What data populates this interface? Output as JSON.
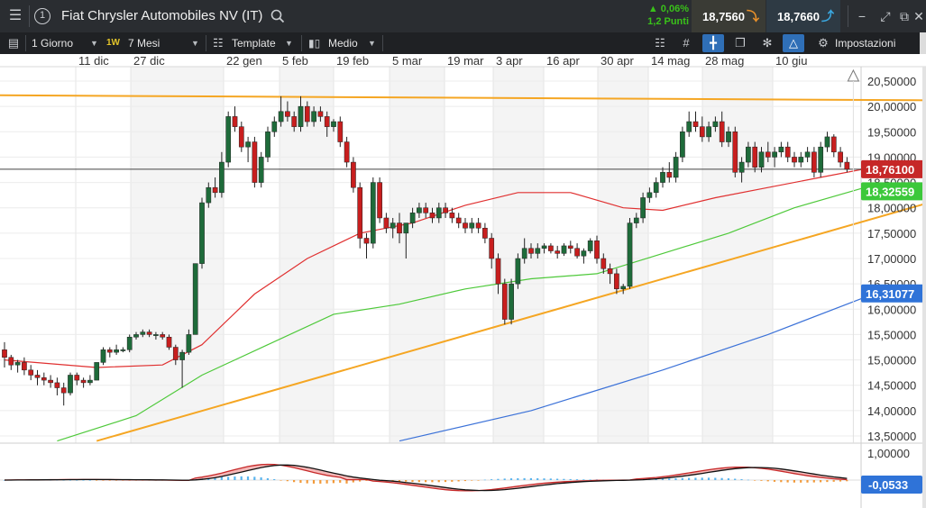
{
  "title_bar": {
    "menu_icon": "hamburger-menu-icon",
    "info_icon_glyph": "1",
    "instrument_name": "Fiat Chrysler Automobiles NV (IT)",
    "change_percent": "▲ 0,06%",
    "change_points": "1,2 Punti",
    "sell_price": "18,7560",
    "buy_price": "18,7660",
    "change_color": "#39c11a",
    "sell_arrow_color": "#e8902a",
    "buy_arrow_color": "#3aa8e0"
  },
  "toolbar": {
    "period_label": "1 Giorno",
    "week_badge": "1W",
    "range_label": "7 Mesi",
    "template_label": "Template",
    "chart_type_label": "Medio",
    "settings_label": "Impostazioni",
    "active_tool": "crosshair-icon"
  },
  "chart_data": {
    "type": "candlestick",
    "x_tick_labels": [
      "11 dic",
      "27 dic",
      "22 gen",
      "5 feb",
      "19 feb",
      "5 mar",
      "19 mar",
      "3 apr",
      "16 apr",
      "30 apr",
      "14 mag",
      "28 mag",
      "10 giu"
    ],
    "y_tick_labels": [
      "20,50000",
      "20,00000",
      "19,50000",
      "19,00000",
      "18,50000",
      "18,00000",
      "17,50000",
      "17,00000",
      "16,50000",
      "16,00000",
      "15,50000",
      "15,00000",
      "14,50000",
      "14,00000",
      "13,50000"
    ],
    "ylim": [
      13.4,
      20.6
    ],
    "candles": [
      [
        15.2,
        15.35,
        14.85,
        15.05
      ],
      [
        15.05,
        15.1,
        14.8,
        14.9
      ],
      [
        14.9,
        15.0,
        14.75,
        14.95
      ],
      [
        14.95,
        15.05,
        14.7,
        14.8
      ],
      [
        14.8,
        14.9,
        14.6,
        14.7
      ],
      [
        14.7,
        14.8,
        14.5,
        14.65
      ],
      [
        14.65,
        14.75,
        14.5,
        14.6
      ],
      [
        14.6,
        14.7,
        14.45,
        14.55
      ],
      [
        14.55,
        14.65,
        14.3,
        14.45
      ],
      [
        14.45,
        14.55,
        14.1,
        14.35
      ],
      [
        14.35,
        14.75,
        14.3,
        14.7
      ],
      [
        14.7,
        14.75,
        14.5,
        14.6
      ],
      [
        14.6,
        14.65,
        14.45,
        14.55
      ],
      [
        14.55,
        14.7,
        14.5,
        14.6
      ],
      [
        14.6,
        14.95,
        14.6,
        14.95
      ],
      [
        14.95,
        15.25,
        14.9,
        15.2
      ],
      [
        15.2,
        15.25,
        15.05,
        15.15
      ],
      [
        15.15,
        15.3,
        15.1,
        15.2
      ],
      [
        15.2,
        15.25,
        15.15,
        15.2
      ],
      [
        15.2,
        15.5,
        15.15,
        15.45
      ],
      [
        15.45,
        15.55,
        15.4,
        15.5
      ],
      [
        15.5,
        15.6,
        15.45,
        15.55
      ],
      [
        15.55,
        15.6,
        15.45,
        15.5
      ],
      [
        15.5,
        15.55,
        15.4,
        15.5
      ],
      [
        15.5,
        15.55,
        15.4,
        15.45
      ],
      [
        15.45,
        15.5,
        15.2,
        15.25
      ],
      [
        15.25,
        15.3,
        14.9,
        15.0
      ],
      [
        15.0,
        15.2,
        14.45,
        15.15
      ],
      [
        15.15,
        15.6,
        15.1,
        15.5
      ],
      [
        15.5,
        16.9,
        15.5,
        16.9
      ],
      [
        16.9,
        18.2,
        16.8,
        18.1
      ],
      [
        18.1,
        18.5,
        18.0,
        18.4
      ],
      [
        18.4,
        18.6,
        18.2,
        18.3
      ],
      [
        18.3,
        19.1,
        18.2,
        18.9
      ],
      [
        18.9,
        19.9,
        18.8,
        19.8
      ],
      [
        19.8,
        20.0,
        19.5,
        19.6
      ],
      [
        19.6,
        19.7,
        19.1,
        19.2
      ],
      [
        19.2,
        19.4,
        18.9,
        19.3
      ],
      [
        19.3,
        19.4,
        18.4,
        18.5
      ],
      [
        18.5,
        19.1,
        18.4,
        19.0
      ],
      [
        19.0,
        19.6,
        18.9,
        19.5
      ],
      [
        19.5,
        19.8,
        19.4,
        19.7
      ],
      [
        19.7,
        20.2,
        19.6,
        19.9
      ],
      [
        19.9,
        20.1,
        19.7,
        19.8
      ],
      [
        19.8,
        19.9,
        19.5,
        19.6
      ],
      [
        19.6,
        20.2,
        19.5,
        20.0
      ],
      [
        20.0,
        20.1,
        19.6,
        19.7
      ],
      [
        19.7,
        20.0,
        19.6,
        19.9
      ],
      [
        19.9,
        20.0,
        19.7,
        19.8
      ],
      [
        19.8,
        19.9,
        19.4,
        19.6
      ],
      [
        19.6,
        19.75,
        19.5,
        19.7
      ],
      [
        19.7,
        19.8,
        19.2,
        19.3
      ],
      [
        19.3,
        19.4,
        18.8,
        18.9
      ],
      [
        18.9,
        19.0,
        18.3,
        18.4
      ],
      [
        18.4,
        18.5,
        17.2,
        17.4
      ],
      [
        17.4,
        17.5,
        17.0,
        17.3
      ],
      [
        17.3,
        18.6,
        17.2,
        18.5
      ],
      [
        18.5,
        18.6,
        17.7,
        17.8
      ],
      [
        17.8,
        17.9,
        17.5,
        17.6
      ],
      [
        17.6,
        17.8,
        17.4,
        17.7
      ],
      [
        17.7,
        17.9,
        17.3,
        17.5
      ],
      [
        17.5,
        17.7,
        17.0,
        17.7
      ],
      [
        17.7,
        18.0,
        17.6,
        17.9
      ],
      [
        17.9,
        18.1,
        17.8,
        18.0
      ],
      [
        18.0,
        18.1,
        17.8,
        17.9
      ],
      [
        17.9,
        18.0,
        17.7,
        17.8
      ],
      [
        17.8,
        18.1,
        17.7,
        18.0
      ],
      [
        18.0,
        18.1,
        17.8,
        17.9
      ],
      [
        17.9,
        18.0,
        17.7,
        17.8
      ],
      [
        17.8,
        17.9,
        17.6,
        17.7
      ],
      [
        17.7,
        17.8,
        17.5,
        17.6
      ],
      [
        17.6,
        17.8,
        17.5,
        17.7
      ],
      [
        17.7,
        17.8,
        17.5,
        17.6
      ],
      [
        17.6,
        17.7,
        17.3,
        17.4
      ],
      [
        17.4,
        17.5,
        16.8,
        17.0
      ],
      [
        17.0,
        17.1,
        16.3,
        16.5
      ],
      [
        16.5,
        16.6,
        15.7,
        15.8
      ],
      [
        15.8,
        16.6,
        15.7,
        16.5
      ],
      [
        16.5,
        17.1,
        16.4,
        17.0
      ],
      [
        17.0,
        17.4,
        16.9,
        17.2
      ],
      [
        17.2,
        17.3,
        17.0,
        17.1
      ],
      [
        17.1,
        17.3,
        17.0,
        17.2
      ],
      [
        17.2,
        17.3,
        17.1,
        17.25
      ],
      [
        17.25,
        17.3,
        17.1,
        17.15
      ],
      [
        17.15,
        17.25,
        17.0,
        17.1
      ],
      [
        17.1,
        17.3,
        17.05,
        17.25
      ],
      [
        17.25,
        17.35,
        17.1,
        17.2
      ],
      [
        17.2,
        17.3,
        17.0,
        17.05
      ],
      [
        17.05,
        17.2,
        16.9,
        17.15
      ],
      [
        17.15,
        17.4,
        17.1,
        17.35
      ],
      [
        17.35,
        17.45,
        16.9,
        17.0
      ],
      [
        17.0,
        17.1,
        16.7,
        16.8
      ],
      [
        16.8,
        16.9,
        16.5,
        16.7
      ],
      [
        16.7,
        16.8,
        16.3,
        16.4
      ],
      [
        16.4,
        16.5,
        16.3,
        16.45
      ],
      [
        16.45,
        17.8,
        16.4,
        17.7
      ],
      [
        17.7,
        17.9,
        17.6,
        17.8
      ],
      [
        17.8,
        18.3,
        17.7,
        18.2
      ],
      [
        18.2,
        18.4,
        18.1,
        18.3
      ],
      [
        18.3,
        18.6,
        18.2,
        18.5
      ],
      [
        18.5,
        18.8,
        18.4,
        18.7
      ],
      [
        18.7,
        18.9,
        18.5,
        18.6
      ],
      [
        18.6,
        19.1,
        18.5,
        19.0
      ],
      [
        19.0,
        19.6,
        18.9,
        19.5
      ],
      [
        19.5,
        19.9,
        19.4,
        19.7
      ],
      [
        19.7,
        19.9,
        19.5,
        19.6
      ],
      [
        19.6,
        19.8,
        19.3,
        19.4
      ],
      [
        19.4,
        19.7,
        19.3,
        19.6
      ],
      [
        19.6,
        19.8,
        19.5,
        19.7
      ],
      [
        19.7,
        19.9,
        19.2,
        19.3
      ],
      [
        19.3,
        19.6,
        19.2,
        19.5
      ],
      [
        19.5,
        19.6,
        18.6,
        18.7
      ],
      [
        18.7,
        19.0,
        18.5,
        18.9
      ],
      [
        18.9,
        19.3,
        18.8,
        19.2
      ],
      [
        19.2,
        19.3,
        18.7,
        18.8
      ],
      [
        18.8,
        19.2,
        18.7,
        19.1
      ],
      [
        19.1,
        19.3,
        18.9,
        19.0
      ],
      [
        19.0,
        19.2,
        18.8,
        19.1
      ],
      [
        19.1,
        19.3,
        19.0,
        19.2
      ],
      [
        19.2,
        19.3,
        18.9,
        19.0
      ],
      [
        19.0,
        19.1,
        18.8,
        18.9
      ],
      [
        18.9,
        19.1,
        18.8,
        19.0
      ],
      [
        19.0,
        19.2,
        18.9,
        19.1
      ],
      [
        19.1,
        19.2,
        18.6,
        18.7
      ],
      [
        18.7,
        19.3,
        18.6,
        19.2
      ],
      [
        19.2,
        19.5,
        19.1,
        19.4
      ],
      [
        19.4,
        19.45,
        19.0,
        19.1
      ],
      [
        19.1,
        19.2,
        18.8,
        18.9
      ],
      [
        18.9,
        19.0,
        18.7,
        18.76
      ]
    ],
    "overlays": [
      {
        "kind": "moving-average",
        "color": "#e03030",
        "points": [
          [
            0,
            15.0
          ],
          [
            14,
            14.85
          ],
          [
            24,
            14.9
          ],
          [
            30,
            15.3
          ],
          [
            38,
            16.3
          ],
          [
            46,
            17.0
          ],
          [
            54,
            17.5
          ],
          [
            62,
            17.7
          ],
          [
            70,
            18.05
          ],
          [
            78,
            18.3
          ],
          [
            86,
            18.3
          ],
          [
            94,
            18.0
          ],
          [
            100,
            17.95
          ],
          [
            108,
            18.2
          ],
          [
            116,
            18.4
          ],
          [
            124,
            18.6
          ],
          [
            132,
            18.8
          ]
        ]
      },
      {
        "kind": "moving-average",
        "color": "#4ec93a",
        "points": [
          [
            8,
            13.4
          ],
          [
            20,
            13.9
          ],
          [
            30,
            14.7
          ],
          [
            40,
            15.3
          ],
          [
            50,
            15.9
          ],
          [
            60,
            16.1
          ],
          [
            70,
            16.4
          ],
          [
            80,
            16.6
          ],
          [
            90,
            16.7
          ],
          [
            100,
            17.1
          ],
          [
            110,
            17.5
          ],
          [
            120,
            18.0
          ],
          [
            132,
            18.45
          ]
        ]
      },
      {
        "kind": "moving-average",
        "color": "#3c72d8",
        "points": [
          [
            60,
            13.4
          ],
          [
            80,
            14.0
          ],
          [
            100,
            14.8
          ],
          [
            116,
            15.5
          ],
          [
            132,
            16.3
          ]
        ]
      },
      {
        "kind": "trendline",
        "color": "#f5a623",
        "points": [
          [
            -1,
            20.22
          ],
          [
            170,
            20.1
          ]
        ]
      },
      {
        "kind": "trendline",
        "color": "#f5a623",
        "points": [
          [
            14,
            13.4
          ],
          [
            170,
            19.2
          ]
        ]
      },
      {
        "kind": "hline",
        "color": "#444444",
        "value": 18.761
      }
    ],
    "price_labels": [
      {
        "text": "18,76100",
        "value": 18.761,
        "color": "#c62828"
      },
      {
        "text": "18,32559",
        "value": 18.3256,
        "color": "#3cc83a"
      },
      {
        "text": "16,31077",
        "value": 16.3108,
        "color": "#2f73d8"
      }
    ],
    "oscillator": {
      "y_tick_label": "1,00000",
      "value_label": "-0,0533",
      "value_color": "#2f73d8",
      "line_color": "#c62828",
      "signal_color": "#111111"
    }
  }
}
